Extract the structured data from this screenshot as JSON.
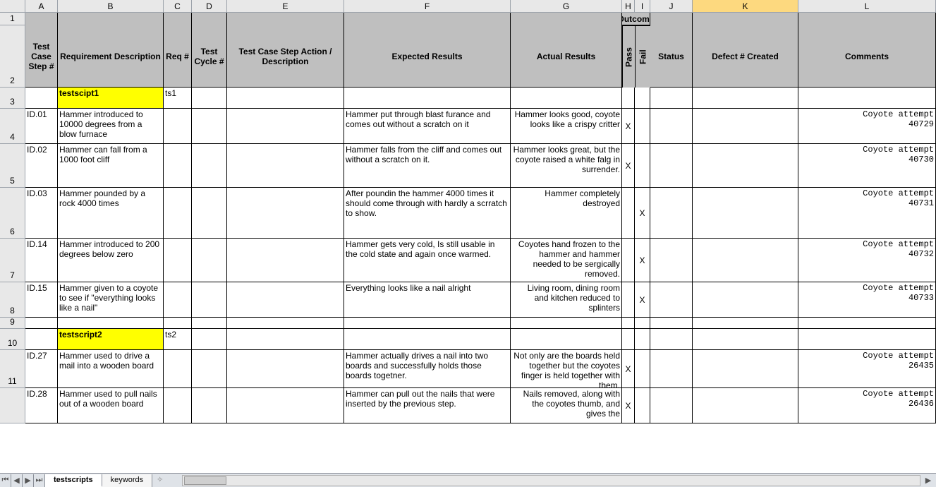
{
  "columns": [
    "A",
    "B",
    "C",
    "D",
    "E",
    "F",
    "G",
    "H",
    "I",
    "J",
    "K",
    "L"
  ],
  "selectedCol": "K",
  "rowNums": [
    "1",
    "2",
    "3",
    "4",
    "5",
    "6",
    "7",
    "8",
    "9",
    "10",
    "11"
  ],
  "outcomeLabel": "Outcome",
  "headers": {
    "A": "Test Case Step #",
    "B": "Requirement Description",
    "C": "Req #",
    "D": "Test Cycle #",
    "E": "Test Case Step Action / Description",
    "F": "Expected Results",
    "G": "Actual Results",
    "H": "Pass",
    "I": "Fail",
    "J": "Status",
    "K": "Defect # Created",
    "L": "Comments"
  },
  "rows": [
    {
      "type": "script",
      "B": "testscipt1",
      "C": "ts1"
    },
    {
      "A": "ID.01",
      "B": "Hammer introduced to 10000 degrees from a blow furnace",
      "F": "Hammer put through blast furance and comes out without a scratch on it",
      "G": "Hammer looks good, coyote looks like a crispy critter",
      "H": "X",
      "L": "Coyote attempt 40729"
    },
    {
      "A": "ID.02",
      "B": "Hammer can fall from a 1000 foot cliff",
      "F": "Hammer falls from the cliff and comes out without a scratch on it.",
      "G": "Hammer looks great, but the coyote raised a white falg in surrender.",
      "H": "X",
      "L": "Coyote attempt 40730"
    },
    {
      "A": "ID.03",
      "B": "Hammer pounded by a rock 4000 times",
      "F": "After poundin the hammer 4000 times it should come through with hardly a scrratch to show.",
      "G": "Hammer completely destroyed",
      "I": "X",
      "L": "Coyote attempt 40731"
    },
    {
      "A": "ID.14",
      "B": "Hammer introduced to 200 degrees below zero",
      "F": "Hammer gets very cold, Is still usable in the cold state and again once warmed.",
      "G": "Coyotes hand frozen to the hammer and hammer needed to be sergically removed.",
      "I": "X",
      "L": "Coyote attempt 40732"
    },
    {
      "A": "ID.15",
      "B": "Hammer given to a coyote to see if \"everything looks like a nail\"",
      "F": "Everything looks like a nail alright",
      "G": "Living room, dining room and kitchen reduced to splinters",
      "I": "X",
      "L": "Coyote attempt 40733"
    },
    {
      "type": "blank"
    },
    {
      "type": "script",
      "B": "testscript2",
      "C": "ts2"
    },
    {
      "A": "ID.27",
      "B": "Hammer used to drive a mail into a wooden board",
      "F": "Hammer actually drives a nail into two boards and successfully holds those boards togetner.",
      "G": "Not only are the boards held together but the coyotes finger is held together with them.",
      "H": "X",
      "L": "Coyote attempt 26435"
    },
    {
      "A": "ID.28",
      "B": "Hammer used to pull nails out of a wooden board",
      "F": "Hammer can pull out the nails that were inserted by the previous step.",
      "G": "Nails removed, along with the coyotes thumb, and gives the",
      "H": "X",
      "L": "Coyote attempt 26436"
    }
  ],
  "rowHeights": {
    "header1": 18,
    "header2": 88,
    "script": 30,
    "blank": 16,
    "r0": 50,
    "r1": 50,
    "r2": 62,
    "r3": 72,
    "r4": 62,
    "r7": 86,
    "r8": 54
  },
  "tabs": {
    "active": "testscripts",
    "items": [
      "testscripts",
      "keywords"
    ]
  }
}
